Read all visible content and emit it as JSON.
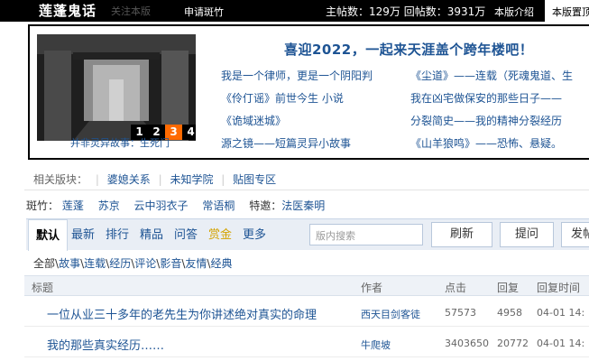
{
  "topbar": {
    "logo": "莲蓬鬼话",
    "follow": "关注本版",
    "apply": "申请斑竹",
    "stats": "主帖数：129万 回帖数：3931万",
    "intro": "本版介绍",
    "pinned": "本版置顶"
  },
  "banner": {
    "pager": [
      "1",
      "2",
      "3",
      "4"
    ],
    "active_page": "3",
    "caption": "并非灵异故事：生死门",
    "headline": "喜迎2022，一起来天涯盖个跨年楼吧！",
    "links": [
      "我是一个律师，更是一个阴阳判",
      "《尘道》——连载（死魂鬼道、生",
      "《伶仃谣》前世今生 小说",
      "我在凶宅做保安的那些日子——",
      "《诡域迷城》",
      "分裂简史——我的精神分裂经历",
      "源之镜——短篇灵异小故事",
      "《山羊狼鸣》——恐怖、悬疑。"
    ]
  },
  "related": {
    "label": "相关版块：",
    "items": [
      "婆媳关系",
      "未知学院",
      "贴图专区"
    ]
  },
  "banzhu": {
    "label": "斑竹：",
    "items": [
      "莲蓬",
      "苏京",
      "云中羽衣子",
      "常语桐"
    ],
    "special_label": "特邀：",
    "special": "法医秦明"
  },
  "tabs": {
    "items": [
      "默认",
      "最新",
      "排行",
      "精品",
      "问答",
      "赏金",
      "更多"
    ],
    "search_placeholder": "版内搜索",
    "buttons": [
      "刷新",
      "提问",
      "发帖"
    ]
  },
  "cats": {
    "all": "全部",
    "items": [
      "故事",
      "连载",
      "经历",
      "评论",
      "影音",
      "友情",
      "经典"
    ]
  },
  "table": {
    "headers": [
      "标题",
      "作者",
      "点击",
      "回复",
      "回复时间"
    ],
    "rows": [
      {
        "title": "一位从业三十多年的老先生为你讲述绝对真实的命理",
        "author": "西天目剑客徒",
        "clicks": "57573",
        "replies": "4958",
        "time": "04-01 14:"
      },
      {
        "title": "我的那些真实经历……",
        "author": "牛爬坡",
        "clicks": "3403650",
        "replies": "20772",
        "time": "04-01 14:"
      }
    ]
  },
  "colors": {
    "link": "#1e5494",
    "active_page": "#ff6a00",
    "topbar": "#000000",
    "tab_bg": "#e9eef5",
    "gold": "#d4a300"
  }
}
